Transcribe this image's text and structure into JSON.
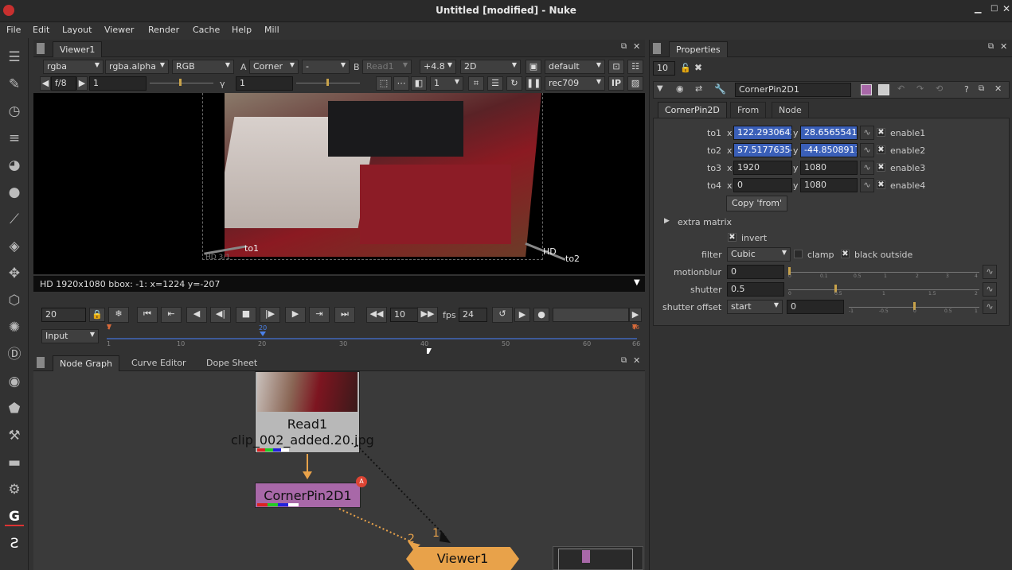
{
  "window": {
    "title": "Untitled [modified] - Nuke"
  },
  "menubar": [
    "File",
    "Edit",
    "Layout",
    "Viewer",
    "Render",
    "Cache",
    "Help",
    "Mill"
  ],
  "viewer": {
    "tab": "Viewer1",
    "channels": "rgba",
    "alpha": "rgba.alpha",
    "display": "RGB",
    "a_label": "A",
    "a_input": "Corner",
    "ab_sep": "-",
    "b_label": "B",
    "b_input": "Read1",
    "zoom": "+4.8",
    "view": "2D",
    "lut": "default",
    "fstop": "f/8",
    "gain": "1",
    "gamma_label": "γ",
    "gamma": "1",
    "frame_ratio": "1",
    "colorspace": "rec709",
    "ip": "IP",
    "gain_ticks": [
      "0.03125",
      "0.0625",
      "0.125",
      "0.25",
      "0.5",
      "1",
      "2",
      "4",
      "8",
      "16",
      "32",
      "64"
    ],
    "status": "HD 1920x1080 bbox: -1:  x=1224 y=-207",
    "overlay": {
      "to1": "to1",
      "to2": "to2",
      "hd": "HD",
      "hd2": "HD 3/1"
    },
    "timeline": {
      "frame": "20",
      "step": "10",
      "fps_label": "fps",
      "fps": "24",
      "input": "Input",
      "ticks": [
        "1",
        "10",
        "20",
        "30",
        "40",
        "50",
        "60",
        "66"
      ],
      "current": "20",
      "start": "1",
      "end": "66"
    }
  },
  "nodegraph": {
    "tabs": [
      "Node Graph",
      "Curve Editor",
      "Dope Sheet"
    ],
    "read": {
      "name": "Read1",
      "file": "clip_002_added.20.jpg"
    },
    "cornerpin": {
      "name": "CornerPin2D1",
      "badge": "A"
    },
    "viewer": {
      "name": "Viewer1",
      "in1": "1",
      "in2": "2"
    }
  },
  "properties": {
    "title": "Properties",
    "count": "10",
    "node_name": "CornerPin2D1",
    "tabs": [
      "CornerPin2D",
      "From",
      "Node"
    ],
    "to": [
      {
        "label": "to1",
        "x": "122.2930642",
        "y": "28.6565541",
        "enable": "enable1",
        "selected": true
      },
      {
        "label": "to2",
        "x": "57.51776354",
        "y": "-44.8508917",
        "enable": "enable2",
        "selected": true
      },
      {
        "label": "to3",
        "x": "1920",
        "y": "1080",
        "enable": "enable3",
        "selected": false
      },
      {
        "label": "to4",
        "x": "0",
        "y": "1080",
        "enable": "enable4",
        "selected": false
      }
    ],
    "xlabel": "x",
    "ylabel": "y",
    "copy_from": "Copy 'from'",
    "extra_matrix": "extra matrix",
    "invert": "invert",
    "filter_label": "filter",
    "filter": "Cubic",
    "clamp": "clamp",
    "black_outside": "black outside",
    "motionblur_label": "motionblur",
    "motionblur": "0",
    "motionblur_ticks": [
      "0",
      "0.1",
      "0.5",
      "1",
      "2",
      "3",
      "4"
    ],
    "shutter_label": "shutter",
    "shutter": "0.5",
    "shutter_ticks": [
      "0",
      "0.5",
      "1",
      "1.5",
      "2"
    ],
    "shutter_offset_label": "shutter offset",
    "shutter_offset": "start",
    "shutter_offset_value": "0",
    "offset_ticks": [
      "-1",
      "-0.5",
      "0",
      "0.5",
      "1"
    ]
  }
}
